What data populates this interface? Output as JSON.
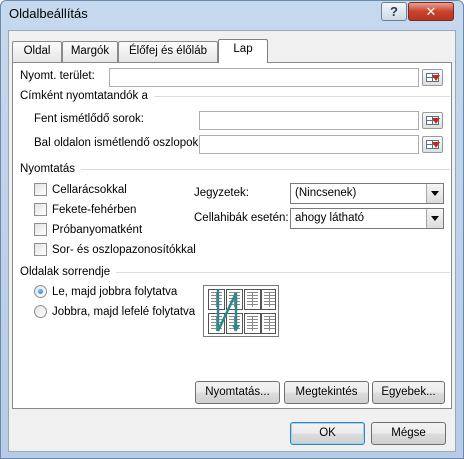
{
  "window": {
    "title": "Oldalbeállítás",
    "help_label": "?",
    "close_label": "✕"
  },
  "tabs": [
    {
      "label": "Oldal",
      "active": false
    },
    {
      "label": "Margók",
      "active": false
    },
    {
      "label": "Élőfej és élőláb",
      "active": false
    },
    {
      "label": "Lap",
      "active": true
    }
  ],
  "print_area": {
    "label": "Nyomt. terület:",
    "value": ""
  },
  "print_titles": {
    "heading": "Címként nyomtatandók a",
    "rows_label": "Fent ismétlődő sorok:",
    "rows_value": "",
    "cols_label": "Bal oldalon ismétlendő oszlopok:",
    "cols_value": ""
  },
  "print": {
    "heading": "Nyomtatás",
    "checkboxes": [
      {
        "label": "Cellarácsokkal",
        "checked": false
      },
      {
        "label": "Fekete-fehérben",
        "checked": false
      },
      {
        "label": "Próbanyomatként",
        "checked": false
      },
      {
        "label": "Sor- és oszlopazonosítókkal",
        "checked": false
      }
    ],
    "comments_label": "Jegyzetek:",
    "comments_value": "(Nincsenek)",
    "errors_label": "Cellahibák esetén:",
    "errors_value": "ahogy látható"
  },
  "page_order": {
    "heading": "Oldalak sorrendje",
    "options": [
      {
        "label": "Le, majd jobbra folytatva",
        "selected": true
      },
      {
        "label": "Jobbra, majd lefelé folytatva",
        "selected": false
      }
    ]
  },
  "buttons": {
    "print": "Nyomtatás...",
    "preview": "Megtekintés",
    "options": "Egyebek...",
    "ok": "OK",
    "cancel": "Mégse"
  },
  "icons": {
    "ref_button": "collapse-dialog-icon",
    "order_preview": "page-order-preview-icon",
    "accent": "#1a6fc4",
    "arrow_color": "#2a8a8a"
  }
}
